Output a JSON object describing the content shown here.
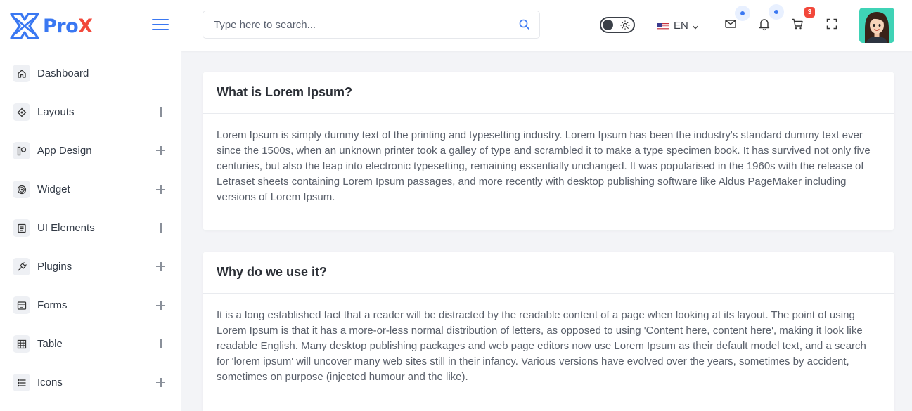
{
  "brand": {
    "name_part1": "Pro",
    "name_part2": "X"
  },
  "search": {
    "placeholder": "Type here to search..."
  },
  "header": {
    "language": "EN",
    "cart_count": "3"
  },
  "sidebar": {
    "items": [
      {
        "label": "Dashboard",
        "icon": "home-icon",
        "expandable": false
      },
      {
        "label": "Layouts",
        "icon": "diamond-layers-icon",
        "expandable": true
      },
      {
        "label": "App Design",
        "icon": "app-design-icon",
        "expandable": true
      },
      {
        "label": "Widget",
        "icon": "target-icon",
        "expandable": true
      },
      {
        "label": "UI Elements",
        "icon": "document-list-icon",
        "expandable": true
      },
      {
        "label": "Plugins",
        "icon": "plug-icon",
        "expandable": true
      },
      {
        "label": "Forms",
        "icon": "form-icon",
        "expandable": true
      },
      {
        "label": "Table",
        "icon": "grid-table-icon",
        "expandable": true
      },
      {
        "label": "Icons",
        "icon": "bullet-list-icon",
        "expandable": true
      }
    ]
  },
  "main": {
    "cards": [
      {
        "title": "What is Lorem Ipsum?",
        "body": "Lorem Ipsum is simply dummy text of the printing and typesetting industry. Lorem Ipsum has been the industry's standard dummy text ever since the 1500s, when an unknown printer took a galley of type and scrambled it to make a type specimen book. It has survived not only five centuries, but also the leap into electronic typesetting, remaining essentially unchanged. It was popularised in the 1960s with the release of Letraset sheets containing Lorem Ipsum passages, and more recently with desktop publishing software like Aldus PageMaker including versions of Lorem Ipsum."
      },
      {
        "title": "Why do we use it?",
        "body": "It is a long established fact that a reader will be distracted by the readable content of a page when looking at its layout. The point of using Lorem Ipsum is that it has a more-or-less normal distribution of letters, as opposed to using 'Content here, content here', making it look like readable English. Many desktop publishing packages and web page editors now use Lorem Ipsum as their default model text, and a search for 'lorem ipsum' will uncover many web sites still in their infancy. Various versions have evolved over the years, sometimes by accident, sometimes on purpose (injected humour and the like)."
      }
    ]
  },
  "colors": {
    "accent": "#3a78f2",
    "brand_red": "#f2483b",
    "avatar_bg": "#3fd3b6"
  }
}
